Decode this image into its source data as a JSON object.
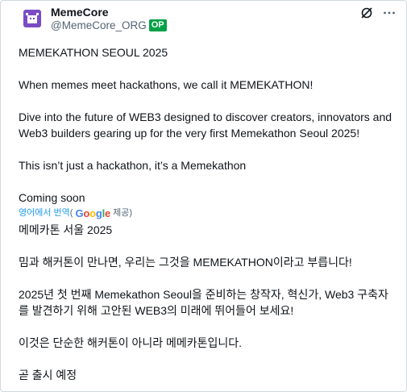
{
  "header": {
    "name": "MemeCore",
    "handle": "@MemeCore_ORG",
    "badge": "OP",
    "brand_color": "#7a4bc4",
    "badge_color": "#00a146"
  },
  "actions": {
    "left_icon": "grok-slash-icon",
    "right_icon": "more-icon"
  },
  "post": {
    "lines": [
      "MEMEKATHON SEOUL 2025",
      "",
      "When memes meet hackathons, we call it MEMEKATHON!",
      "",
      "Dive into the future of WEB3 designed to discover creators, innovators and",
      "Web3 builders gearing up for the very first Memekathon Seoul 2025!",
      "",
      "This isn’t just a hackathon, it’s a Memekathon",
      "",
      "Coming soon"
    ]
  },
  "translation": {
    "link_text": "영어에서 번역",
    "paren_open": "(",
    "google": "Google",
    "provided": "제공)",
    "lines": [
      "메메카톤 서울 2025",
      "",
      "밈과 해커톤이 만나면, 우리는 그것을 MEMEKATHON이라고 부릅니다!",
      "",
      "2025년 첫 번째 Memekathon Seoul을 준비하는 창작자, 혁신가, Web3 구축자",
      "를 발견하기 위해 고안된 WEB3의 미래에 뛰어들어 보세요!",
      "",
      "이것은 단순한 해커톤이 아니라 메메카톤입니다.",
      "",
      "곧 출시 예정"
    ]
  }
}
